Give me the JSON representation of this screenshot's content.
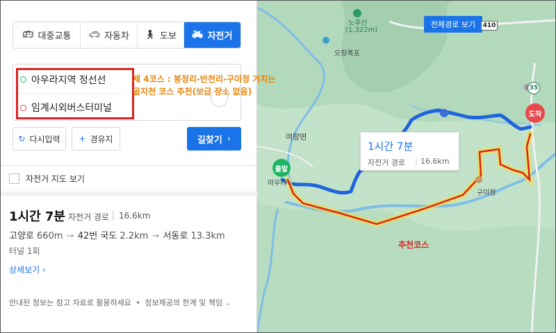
{
  "modes": [
    {
      "label": "대중교통",
      "icon": "bus-icon",
      "active": false
    },
    {
      "label": "자동차",
      "icon": "car-icon",
      "active": false
    },
    {
      "label": "도보",
      "icon": "walk-icon",
      "active": false
    },
    {
      "label": "자전거",
      "icon": "bicycle-icon",
      "active": true
    }
  ],
  "route": {
    "origin": "아우라지역 정선선",
    "destination": "임계시외버스터미널"
  },
  "buttons": {
    "reset": "다시입력",
    "waypoint": "경유지",
    "search": "길찾기"
  },
  "bike_map_toggle": "자전거 지도 보기",
  "summary": {
    "time": "1시간 7분",
    "type": "자전거 경로",
    "distance": "16.6km",
    "roads": [
      {
        "name": "고양로",
        "dist": "660m"
      },
      {
        "name": "42번 국도",
        "dist": "2.2km"
      },
      {
        "name": "서동로",
        "dist": "13.3km"
      }
    ],
    "tunnel": "터널 1회",
    "detail_link": "상세보기"
  },
  "notice": {
    "text1": "안내된 정보는 참고 자료로 활용하세요",
    "text2": "정보제공의 한계 및 책임"
  },
  "map": {
    "full_route_button": "전체경로 보기",
    "road_410": "410",
    "road_35": "35",
    "mountain_name": "노추산",
    "mountain_elev": "(1,322m)",
    "falls": "오장폭포",
    "yeoryang": "여량면",
    "aura": "아우라",
    "gumijeong": "구미정",
    "start_marker": "출발",
    "end_marker": "도착",
    "card": {
      "time": "1시간 7분",
      "type": "자전거 경로",
      "distance": "16.6km"
    },
    "annotation_line1": "제 4코스 : 봉정리-반천리-구미정 거치는",
    "annotation_line2": "골지천 코스 추천(보급 장소 없음)",
    "recommend_label": "추천코스"
  },
  "colors": {
    "accent": "#1a73e8",
    "route_line": "#1e64dc",
    "annotation": "#e8850b",
    "highlight": "#e02020",
    "map_bg": "#a7d3b2",
    "river": "#6ab0e0"
  }
}
